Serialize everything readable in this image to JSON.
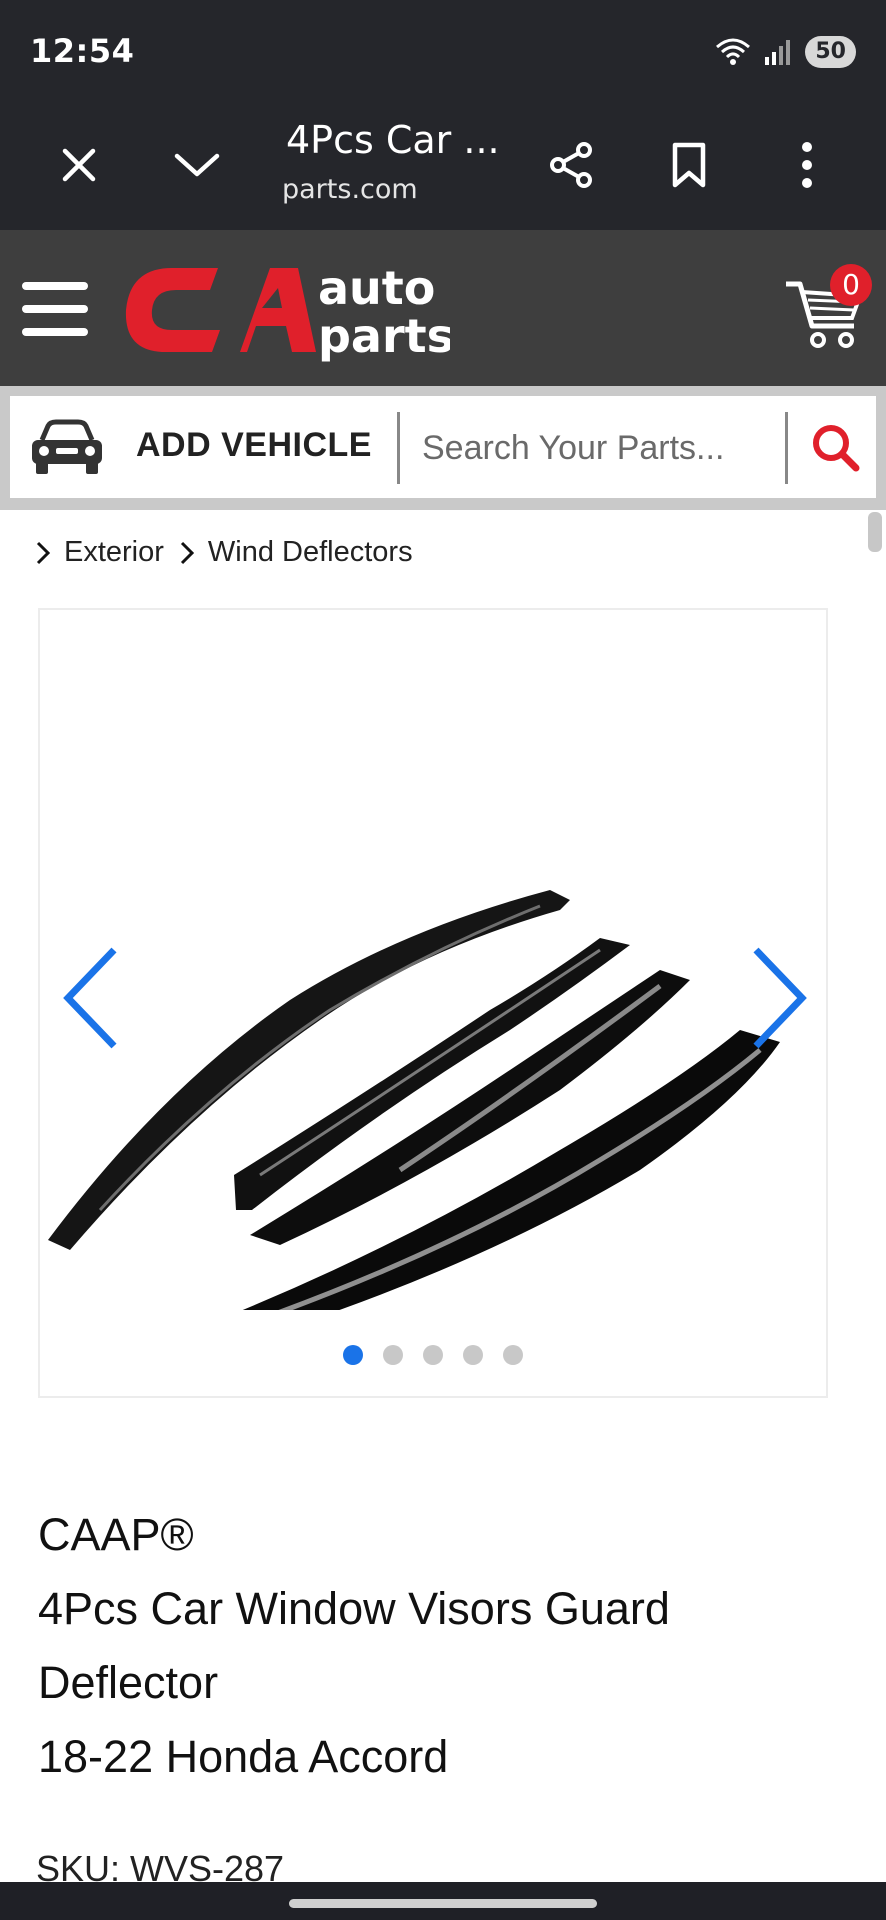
{
  "status_bar": {
    "time": "12:54",
    "battery": "50",
    "icons": [
      "wifi-icon",
      "signal-icon",
      "battery-icon"
    ]
  },
  "browser": {
    "tab_title": "4Pcs Car ...",
    "url": "parts.com",
    "icons": [
      "close-icon",
      "chevron-down-icon",
      "share-icon",
      "bookmark-icon",
      "more-vertical-icon"
    ]
  },
  "header": {
    "logo_text_top": "auto",
    "logo_text_bottom": "parts",
    "cart_count": "0",
    "brand_color": "#e0202b"
  },
  "search": {
    "add_vehicle_label": "ADD VEHICLE",
    "placeholder": "Search Your Parts..."
  },
  "breadcrumb": [
    {
      "label": "Exterior"
    },
    {
      "label": "Wind Deflectors"
    }
  ],
  "gallery": {
    "slide_count": 5,
    "active_slide": 1,
    "accent_color": "#1a73e8"
  },
  "product": {
    "brand": "CAAP®",
    "title_lines": [
      "4Pcs Car Window Visors Guard",
      "Deflector",
      "18-22 Honda Accord"
    ],
    "sku": "SKU: WVS-287"
  }
}
